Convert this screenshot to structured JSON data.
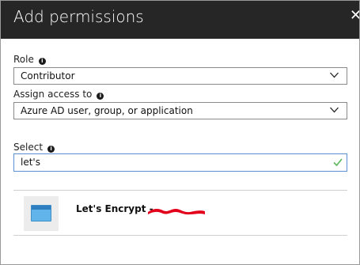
{
  "dialog": {
    "title": "Add permissions",
    "close_glyph": "✕"
  },
  "role": {
    "label": "Role",
    "value": "Contributor"
  },
  "assign_access": {
    "label": "Assign access to",
    "value": "Azure AD user, group, or application"
  },
  "select": {
    "label": "Select",
    "value": "let's"
  },
  "results": [
    {
      "name": "Let's Encrypt - ",
      "icon": "app-window-icon",
      "redacted": true
    }
  ],
  "colors": {
    "header_bg": "#262626",
    "focus_border": "#5a8fd6",
    "valid_check": "#5cb85c",
    "redaction": "#e3001b",
    "app_icon": "#5fb5ea"
  },
  "icons": {
    "info": "info-icon",
    "dropdown": "chevron-down-icon",
    "valid": "checkmark-icon",
    "close": "close-icon"
  }
}
